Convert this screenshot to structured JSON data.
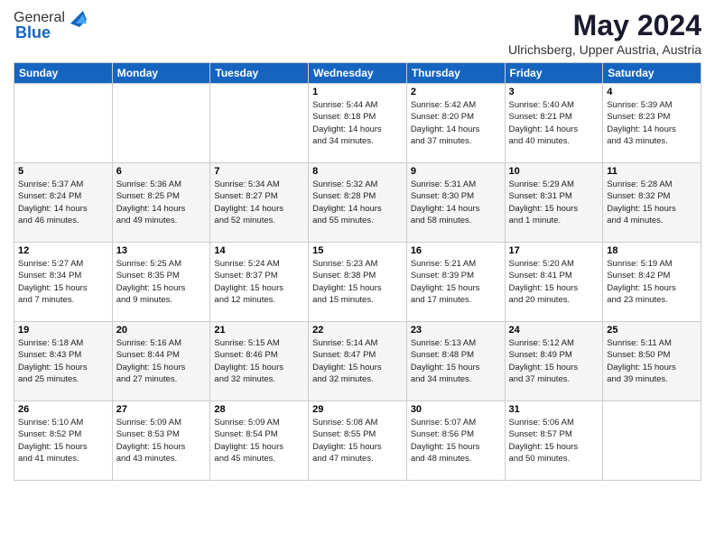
{
  "header": {
    "logo_general": "General",
    "logo_blue": "Blue",
    "month": "May 2024",
    "location": "Ulrichsberg, Upper Austria, Austria"
  },
  "weekdays": [
    "Sunday",
    "Monday",
    "Tuesday",
    "Wednesday",
    "Thursday",
    "Friday",
    "Saturday"
  ],
  "weeks": [
    [
      {
        "day": "",
        "info": ""
      },
      {
        "day": "",
        "info": ""
      },
      {
        "day": "",
        "info": ""
      },
      {
        "day": "1",
        "info": "Sunrise: 5:44 AM\nSunset: 8:18 PM\nDaylight: 14 hours\nand 34 minutes."
      },
      {
        "day": "2",
        "info": "Sunrise: 5:42 AM\nSunset: 8:20 PM\nDaylight: 14 hours\nand 37 minutes."
      },
      {
        "day": "3",
        "info": "Sunrise: 5:40 AM\nSunset: 8:21 PM\nDaylight: 14 hours\nand 40 minutes."
      },
      {
        "day": "4",
        "info": "Sunrise: 5:39 AM\nSunset: 8:23 PM\nDaylight: 14 hours\nand 43 minutes."
      }
    ],
    [
      {
        "day": "5",
        "info": "Sunrise: 5:37 AM\nSunset: 8:24 PM\nDaylight: 14 hours\nand 46 minutes."
      },
      {
        "day": "6",
        "info": "Sunrise: 5:36 AM\nSunset: 8:25 PM\nDaylight: 14 hours\nand 49 minutes."
      },
      {
        "day": "7",
        "info": "Sunrise: 5:34 AM\nSunset: 8:27 PM\nDaylight: 14 hours\nand 52 minutes."
      },
      {
        "day": "8",
        "info": "Sunrise: 5:32 AM\nSunset: 8:28 PM\nDaylight: 14 hours\nand 55 minutes."
      },
      {
        "day": "9",
        "info": "Sunrise: 5:31 AM\nSunset: 8:30 PM\nDaylight: 14 hours\nand 58 minutes."
      },
      {
        "day": "10",
        "info": "Sunrise: 5:29 AM\nSunset: 8:31 PM\nDaylight: 15 hours\nand 1 minute."
      },
      {
        "day": "11",
        "info": "Sunrise: 5:28 AM\nSunset: 8:32 PM\nDaylight: 15 hours\nand 4 minutes."
      }
    ],
    [
      {
        "day": "12",
        "info": "Sunrise: 5:27 AM\nSunset: 8:34 PM\nDaylight: 15 hours\nand 7 minutes."
      },
      {
        "day": "13",
        "info": "Sunrise: 5:25 AM\nSunset: 8:35 PM\nDaylight: 15 hours\nand 9 minutes."
      },
      {
        "day": "14",
        "info": "Sunrise: 5:24 AM\nSunset: 8:37 PM\nDaylight: 15 hours\nand 12 minutes."
      },
      {
        "day": "15",
        "info": "Sunrise: 5:23 AM\nSunset: 8:38 PM\nDaylight: 15 hours\nand 15 minutes."
      },
      {
        "day": "16",
        "info": "Sunrise: 5:21 AM\nSunset: 8:39 PM\nDaylight: 15 hours\nand 17 minutes."
      },
      {
        "day": "17",
        "info": "Sunrise: 5:20 AM\nSunset: 8:41 PM\nDaylight: 15 hours\nand 20 minutes."
      },
      {
        "day": "18",
        "info": "Sunrise: 5:19 AM\nSunset: 8:42 PM\nDaylight: 15 hours\nand 23 minutes."
      }
    ],
    [
      {
        "day": "19",
        "info": "Sunrise: 5:18 AM\nSunset: 8:43 PM\nDaylight: 15 hours\nand 25 minutes."
      },
      {
        "day": "20",
        "info": "Sunrise: 5:16 AM\nSunset: 8:44 PM\nDaylight: 15 hours\nand 27 minutes."
      },
      {
        "day": "21",
        "info": "Sunrise: 5:15 AM\nSunset: 8:46 PM\nDaylight: 15 hours\nand 32 minutes."
      },
      {
        "day": "22",
        "info": "Sunrise: 5:14 AM\nSunset: 8:47 PM\nDaylight: 15 hours\nand 32 minutes."
      },
      {
        "day": "23",
        "info": "Sunrise: 5:13 AM\nSunset: 8:48 PM\nDaylight: 15 hours\nand 34 minutes."
      },
      {
        "day": "24",
        "info": "Sunrise: 5:12 AM\nSunset: 8:49 PM\nDaylight: 15 hours\nand 37 minutes."
      },
      {
        "day": "25",
        "info": "Sunrise: 5:11 AM\nSunset: 8:50 PM\nDaylight: 15 hours\nand 39 minutes."
      }
    ],
    [
      {
        "day": "26",
        "info": "Sunrise: 5:10 AM\nSunset: 8:52 PM\nDaylight: 15 hours\nand 41 minutes."
      },
      {
        "day": "27",
        "info": "Sunrise: 5:09 AM\nSunset: 8:53 PM\nDaylight: 15 hours\nand 43 minutes."
      },
      {
        "day": "28",
        "info": "Sunrise: 5:09 AM\nSunset: 8:54 PM\nDaylight: 15 hours\nand 45 minutes."
      },
      {
        "day": "29",
        "info": "Sunrise: 5:08 AM\nSunset: 8:55 PM\nDaylight: 15 hours\nand 47 minutes."
      },
      {
        "day": "30",
        "info": "Sunrise: 5:07 AM\nSunset: 8:56 PM\nDaylight: 15 hours\nand 48 minutes."
      },
      {
        "day": "31",
        "info": "Sunrise: 5:06 AM\nSunset: 8:57 PM\nDaylight: 15 hours\nand 50 minutes."
      },
      {
        "day": "",
        "info": ""
      }
    ]
  ]
}
